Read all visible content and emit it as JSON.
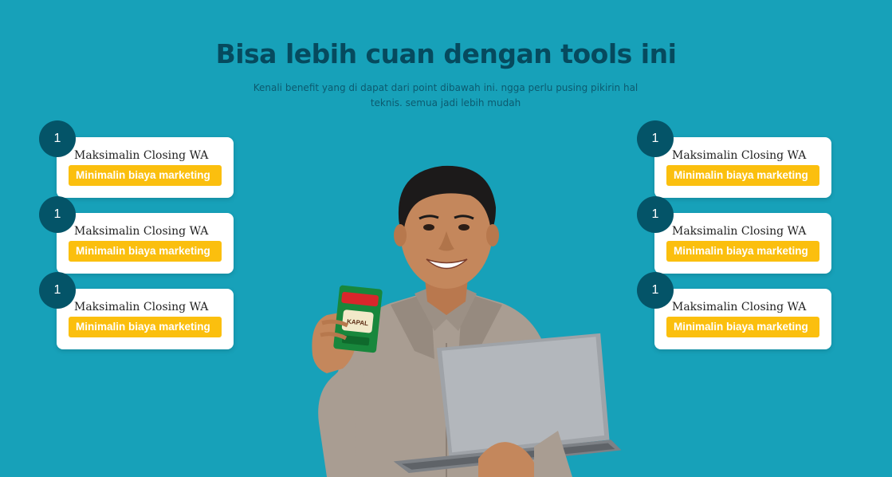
{
  "section": {
    "title": "Bisa lebih cuan dengan tools ini",
    "subtitle": "Kenali benefit yang di dapat dari point dibawah ini. ngga perlu pusing pikirin hal teknis. semua jadi lebih mudah"
  },
  "features_left": [
    {
      "number": "1",
      "title": "Maksimalin Closing WA",
      "badge": "Minimalin biaya marketing"
    },
    {
      "number": "1",
      "title": "Maksimalin Closing WA",
      "badge": "Minimalin biaya marketing"
    },
    {
      "number": "1",
      "title": "Maksimalin Closing WA",
      "badge": "Minimalin biaya marketing"
    }
  ],
  "features_right": [
    {
      "number": "1",
      "title": "Maksimalin Closing WA",
      "badge": "Minimalin biaya marketing"
    },
    {
      "number": "1",
      "title": "Maksimalin Closing WA",
      "badge": "Minimalin biaya marketing"
    },
    {
      "number": "1",
      "title": "Maksimalin Closing WA",
      "badge": "Minimalin biaya marketing"
    }
  ],
  "colors": {
    "background": "#17a1b9",
    "heading": "#064a5e",
    "number_circle": "#045468",
    "badge": "#fbbf0e"
  }
}
